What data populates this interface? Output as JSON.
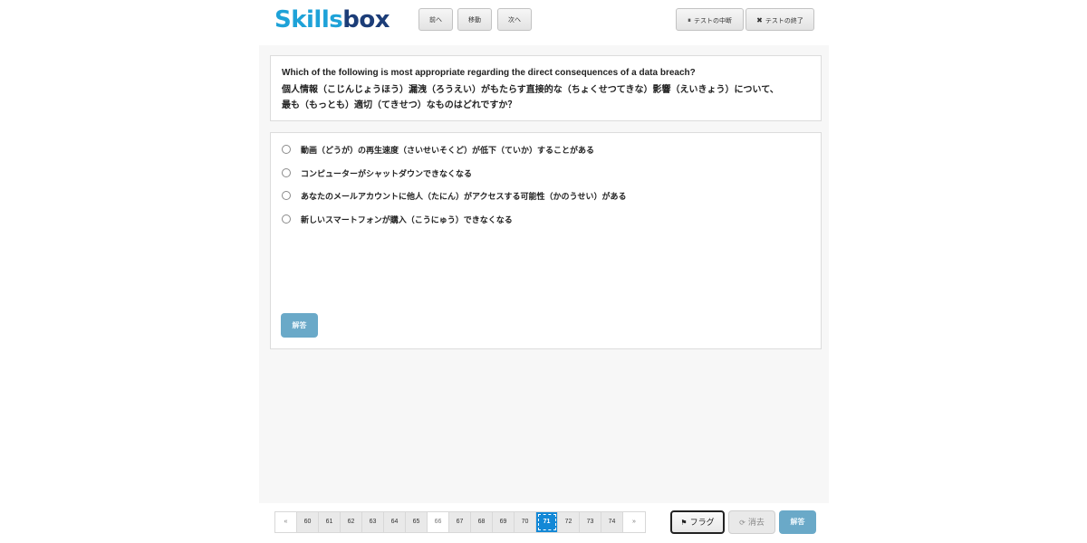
{
  "header": {
    "logo_part1": "Skills",
    "logo_part2": "box",
    "prev_label": "前へ",
    "move_label": "移動",
    "next_label": "次へ",
    "pause_label": "テストの中断",
    "end_label": "テストの終了"
  },
  "question": {
    "en": "Which of the following is most appropriate regarding the direct consequences of a data breach?",
    "jp_line1": "個人情報（こじんじょうほう）漏洩（ろうえい）がもたらす直接的な（ちょくせつてきな）影響（えいきょう）について、",
    "jp_line2": "最も（もっとも）適切（てきせつ）なものはどれですか？"
  },
  "options": [
    "動画（どうが）の再生速度（さいせいそくど）が低下（ていか）することがある",
    "コンピューターがシャットダウンできなくなる",
    "あなたのメールアカウントに他人（たにん）がアクセスする可能性（かのうせい）がある",
    "新しいスマートフォンが購入（こうにゅう）できなくなる"
  ],
  "answer_button": "解答",
  "pager": {
    "prev": "«",
    "next": "»",
    "pages": [
      "60",
      "61",
      "62",
      "63",
      "64",
      "65",
      "66",
      "67",
      "68",
      "69",
      "70",
      "71",
      "72",
      "73",
      "74"
    ],
    "current": "71"
  },
  "footer": {
    "flag_label": "フラグ",
    "clear_label": "消去",
    "answer_label": "解答"
  }
}
